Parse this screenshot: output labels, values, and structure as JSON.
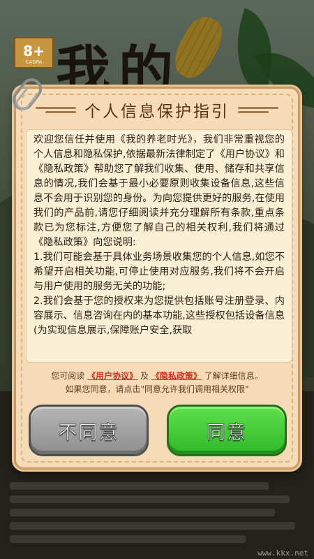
{
  "background": {
    "age_rating": "8+",
    "age_rating_caption": "CADPA",
    "game_title_chars": [
      "我",
      "的"
    ],
    "watermark": "www.kkx.net"
  },
  "dialog": {
    "title": "个人信息保护指引",
    "paragraphs": [
      "欢迎您信任并使用《我的养老时光》，我们非常重视您的个人信息和隐私保护,依据最新法律制定了《用户协议》和《隐私政策》帮助您了解我们收集、使用、储存和共享信息的情况,我们会基于最小必要原则收集设备信息,这些信息不会用于识别您的身份。为向您提供更好的服务,在使用我们的产品前,请您仔细阅读并充分理解所有条款,重点条款已为您标注,方便您了解自己的相关权利,我们将通过《隐私政策》向您说明:",
      "1.我们可能会基于具体业务场景收集您的个人信息,如您不希望开启相关功能,可停止使用对应服务,我们将不会开启与用户使用的服务无关的功能;",
      "2.我们会基于您的授权来为您提供包括账号注册登录、内容展示、信息咨询在内的基本功能,这些授权包括设备信息(为实现信息展示,保障账户安全,获取"
    ],
    "notice_before": "您可阅读",
    "link_user_agreement": "《用户协议》",
    "notice_and": "及",
    "link_privacy_policy": "《隐私政策》",
    "notice_after": "了解详细信息。",
    "notice_line2": "如果您同意，请点击\"同意允许我们调用相关权限\"",
    "btn_disagree": "不同意",
    "btn_agree": "同意"
  },
  "colors": {
    "dialog_bg": "#f5dcb6",
    "link": "#d72b1e",
    "agree_green": "#2eb82a",
    "disagree_gray": "#8e8e8e"
  }
}
